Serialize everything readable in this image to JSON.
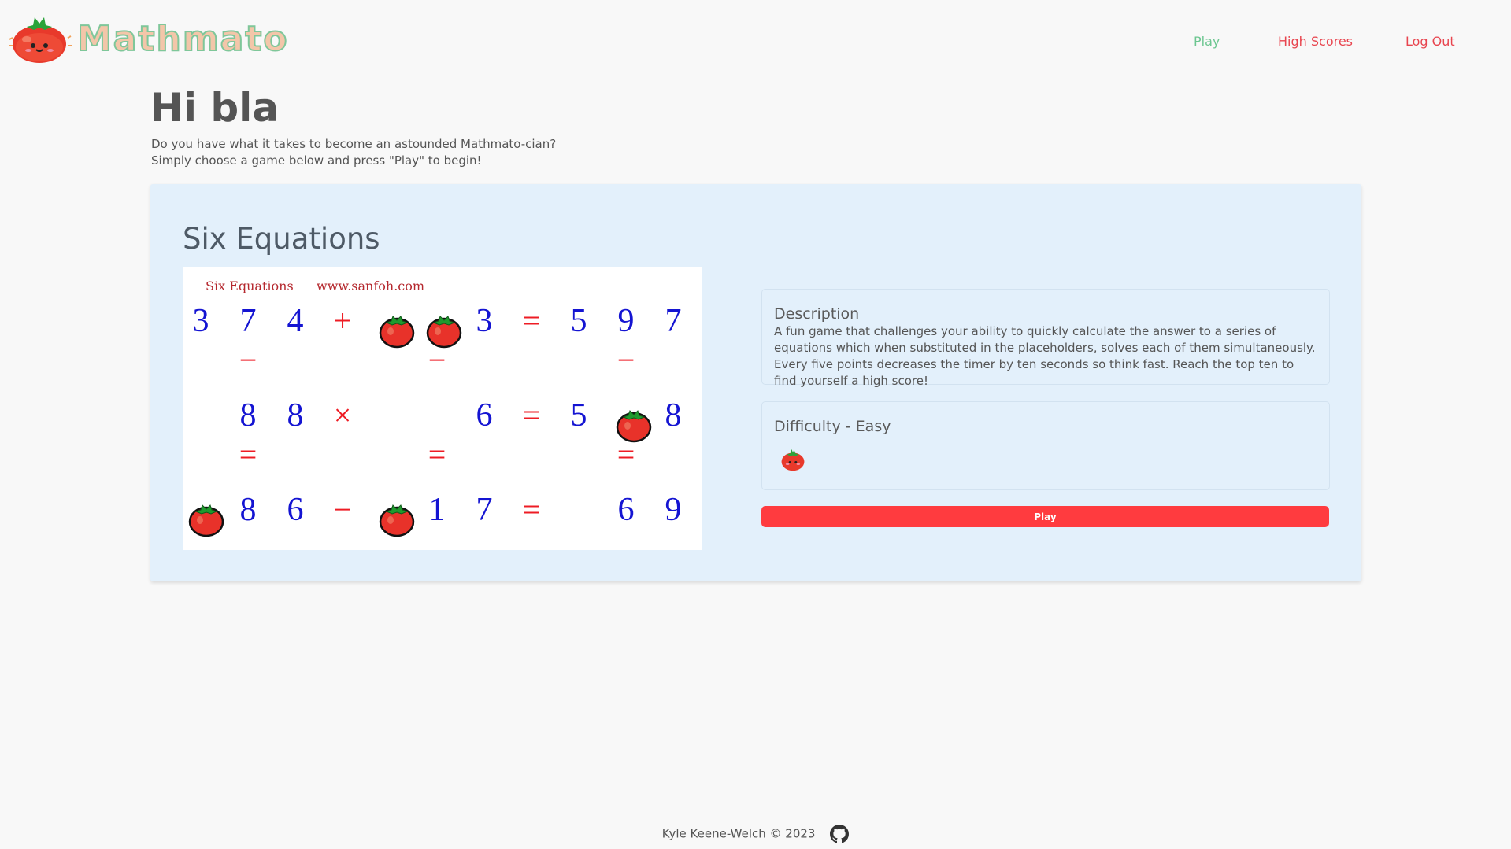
{
  "brand": {
    "name": "Mathmato",
    "logo_icon": "tomato-mascot-icon"
  },
  "nav": {
    "play": "Play",
    "high_scores": "High Scores",
    "log_out": "Log Out"
  },
  "colors": {
    "accent": "#ff3b3f",
    "nav_active": "#6cc690",
    "nav_link": "#e8454f",
    "card_bg": "#e3f0fb"
  },
  "greeting": "Hi bla",
  "intro": {
    "line1": "Do you have what it takes to become an astounded Mathmato-cian?",
    "line2": "Simply choose a game below and press \"Play\" to begin!"
  },
  "game": {
    "title": "Six Equations",
    "preview": {
      "caption_title": "Six Equations",
      "caption_site": "www.sanfoh.com",
      "cells": {
        "r1": [
          "3",
          "7",
          "4",
          "+",
          "",
          "",
          "3",
          "=",
          "5",
          "9",
          "7"
        ],
        "r2": [
          "",
          "−",
          "",
          "",
          "",
          "−",
          "",
          "",
          "",
          "−",
          ""
        ],
        "r3": [
          "",
          "8",
          "8",
          "×",
          "",
          "",
          "6",
          "=",
          "5",
          "",
          "8"
        ],
        "r4": [
          "",
          "=",
          "",
          "",
          "",
          "=",
          "",
          "",
          "",
          "=",
          ""
        ],
        "r5": [
          "",
          "8",
          "6",
          "−",
          "",
          "1",
          "7",
          "=",
          "",
          "6",
          "9"
        ]
      }
    },
    "description_heading": "Description",
    "description": "A fun game that challenges your ability to quickly calculate the answer to a series of equations which when substituted in the placeholders, solves each of them simultaneously. Every five points decreases the timer by ten seconds so think fast. Reach the top ten to find yourself a high score!",
    "difficulty_heading": "Difficulty - Easy",
    "difficulty_level": 1,
    "play_label": "Play"
  },
  "footer": {
    "text": "Kyle Keene-Welch © 2023",
    "icon": "github-icon"
  }
}
